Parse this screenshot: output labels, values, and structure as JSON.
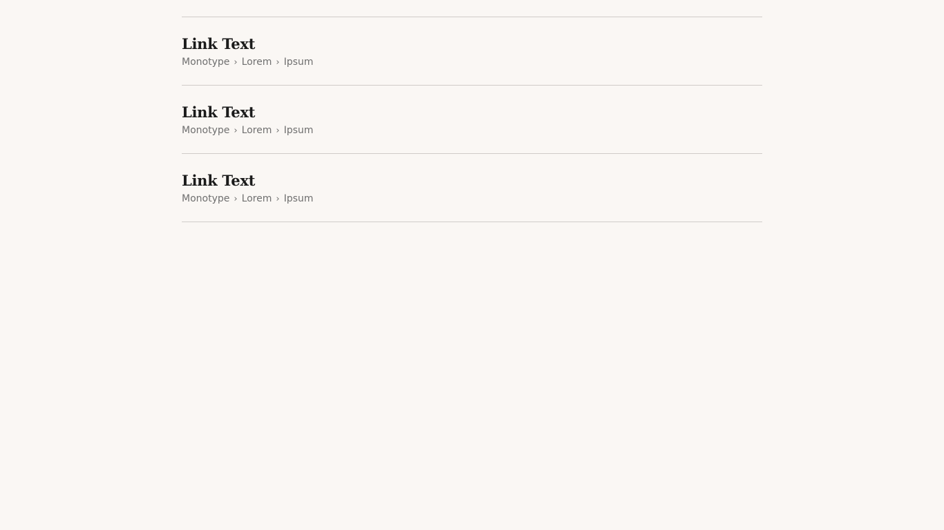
{
  "results": [
    {
      "link_text": "Link Text",
      "breadcrumb": [
        "Monotype",
        "Lorem",
        "Ipsum"
      ],
      "separator": "›"
    },
    {
      "link_text": "Link Text",
      "breadcrumb": [
        "Monotype",
        "Lorem",
        "Ipsum"
      ],
      "separator": "›"
    },
    {
      "link_text": "Link Text",
      "breadcrumb": [
        "Monotype",
        "Lorem",
        "Ipsum"
      ],
      "separator": "›"
    }
  ],
  "colors": {
    "background": "#faf7f4",
    "link": "#1b1b1b",
    "breadcrumb": "#6f6f6f",
    "divider": "#cfcbc8"
  }
}
